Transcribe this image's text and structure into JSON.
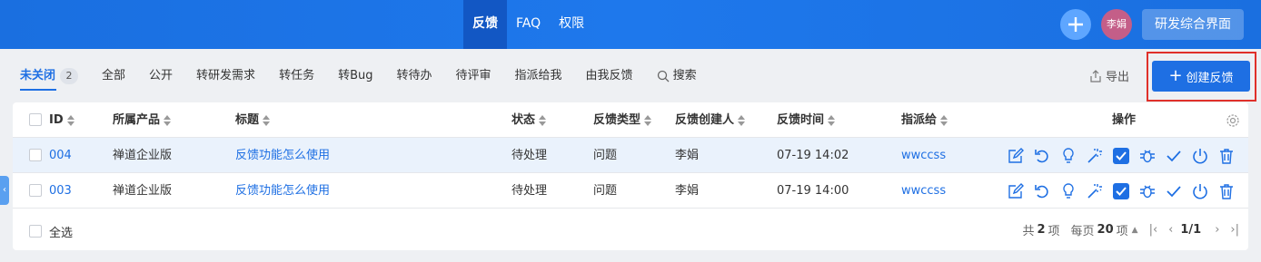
{
  "topnav": {
    "items": [
      {
        "label": "反馈",
        "active": true
      },
      {
        "label": "FAQ",
        "active": false
      },
      {
        "label": "权限",
        "active": false
      }
    ],
    "add_icon": "plus-icon",
    "avatar_name": "李娟",
    "app_switch_label": "研发综合界面"
  },
  "tabs": {
    "items": [
      {
        "label": "未关闭",
        "count": "2",
        "active": true
      },
      {
        "label": "全部"
      },
      {
        "label": "公开"
      },
      {
        "label": "转研发需求"
      },
      {
        "label": "转任务"
      },
      {
        "label": "转Bug"
      },
      {
        "label": "转待办"
      },
      {
        "label": "待评审"
      },
      {
        "label": "指派给我"
      },
      {
        "label": "由我反馈"
      }
    ],
    "search_label": "搜索",
    "export_label": "导出",
    "create_label": "创建反馈"
  },
  "table": {
    "columns": {
      "id": "ID",
      "product": "所属产品",
      "title": "标题",
      "status": "状态",
      "type": "反馈类型",
      "creator": "反馈创建人",
      "time": "反馈时间",
      "assignee": "指派给",
      "actions": "操作"
    },
    "rows": [
      {
        "id": "004",
        "product": "禅道企业版",
        "title": "反馈功能怎么使用",
        "status": "待处理",
        "type": "问题",
        "creator": "李娟",
        "time": "07-19 14:02",
        "assignee": "wwccss"
      },
      {
        "id": "003",
        "product": "禅道企业版",
        "title": "反馈功能怎么使用",
        "status": "待处理",
        "type": "问题",
        "creator": "李娟",
        "time": "07-19 14:00",
        "assignee": "wwccss"
      }
    ],
    "action_icons": [
      "edit-icon",
      "undo-icon",
      "lightbulb-icon",
      "magic-wand-icon",
      "checkbox-icon",
      "bug-icon",
      "check-icon",
      "power-icon",
      "trash-icon"
    ]
  },
  "footer": {
    "select_all_label": "全选",
    "total_prefix": "共",
    "total_count": "2",
    "total_suffix": "项",
    "per_page_prefix": "每页",
    "per_page": "20",
    "per_page_suffix": "项",
    "page_indicator": "1/1"
  },
  "colors": {
    "primary": "#1e6fe3",
    "highlight_border": "#e0302a",
    "row_hover": "#eaf2fc"
  }
}
